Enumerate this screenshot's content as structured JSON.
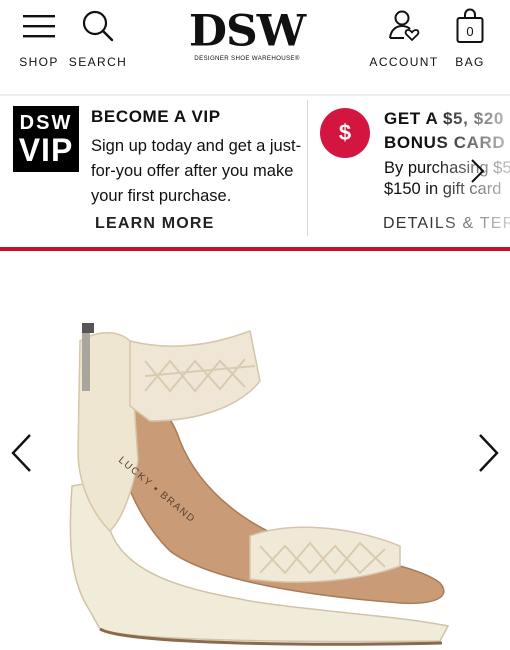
{
  "header": {
    "shop_label": "SHOP",
    "search_label": "SEARCH",
    "logo_text": "DSW",
    "logo_tagline": "DESIGNER SHOE WAREHOUSE®",
    "account_label": "ACCOUNT",
    "bag_label": "BAG",
    "bag_count": "0",
    "icons": {
      "shop": "hamburger-menu-icon",
      "search": "search-icon",
      "account": "account-heart-icon",
      "bag": "shopping-bag-icon"
    }
  },
  "promos": [
    {
      "badge_line1": "DSW",
      "badge_line2": "VIP",
      "title": "BECOME A VIP",
      "text": "Sign up today and get a just-for-you offer after you make your first purchase.",
      "link": "LEARN MORE"
    },
    {
      "icon_glyph": "$",
      "title_line1": "GET A $5, $20",
      "title_line2": "BONUS CARD",
      "text_line1": "By purchasing $5",
      "text_line2": "$150 in gift card",
      "link": "DETAILS & TER"
    }
  ],
  "product": {
    "brand_on_insole": "LUCKY ▪ BRAND"
  },
  "colors": {
    "accent_red": "#c8102e",
    "bonus_icon_red": "#d3153f",
    "black": "#000000"
  }
}
